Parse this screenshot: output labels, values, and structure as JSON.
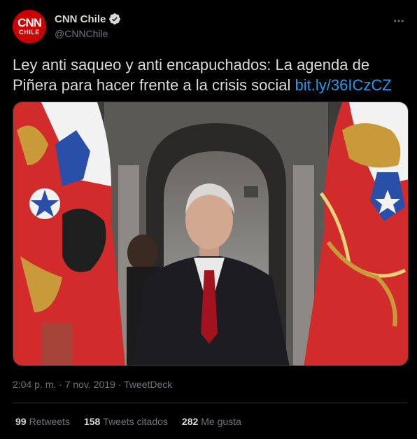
{
  "account": {
    "display_name": "CNN Chile",
    "handle": "@CNNChile",
    "avatar_top": "CNN",
    "avatar_bottom": "CHILE",
    "verified": true,
    "brand_color": "#cc0000"
  },
  "tweet": {
    "text": "Ley anti saqueo y anti encapuchados: La agenda de Piñera para hacer frente a la crisis social ",
    "link": "bit.ly/36ICzCZ",
    "timestamp": "2:04 p. m. · 7 nov. 2019 · TweetDeck"
  },
  "stats": {
    "retweets_count": "99",
    "retweets_label": "Retweets",
    "quotes_count": "158",
    "quotes_label": "Tweets citados",
    "likes_count": "282",
    "likes_label": "Me gusta"
  },
  "icons": {
    "verified": "verified-badge-icon",
    "more": "more-horizontal-icon"
  },
  "colors": {
    "background": "#000000",
    "text": "#d9d9d9",
    "secondary_text": "#6e767d",
    "link": "#1d9bf0",
    "divider": "#2f3336"
  }
}
